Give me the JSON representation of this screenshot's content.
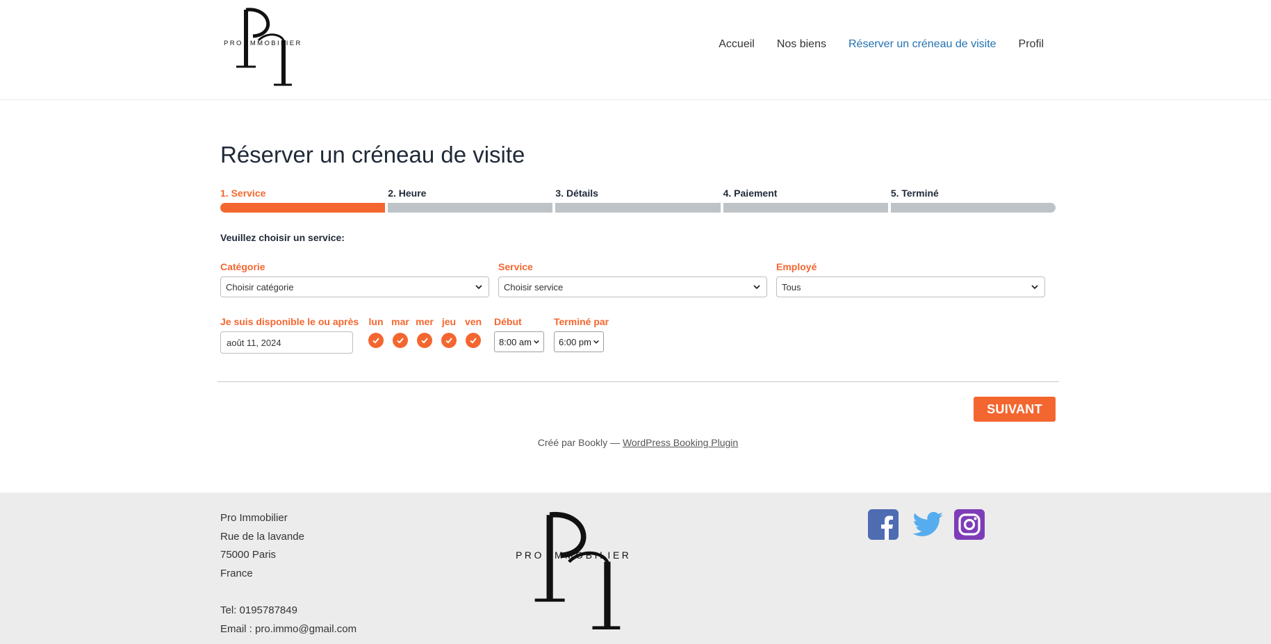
{
  "brand": {
    "logo_text": "PRO IMMOBILIER",
    "accent": "#f4662f",
    "link_active": "#2271b1"
  },
  "nav": {
    "items": [
      {
        "label": "Accueil"
      },
      {
        "label": "Nos biens"
      },
      {
        "label": "Réserver un créneau de visite",
        "active": true
      },
      {
        "label": "Profil"
      }
    ]
  },
  "page": {
    "title": "Réserver un créneau de visite"
  },
  "steps": [
    {
      "label": "1. Service",
      "active": true
    },
    {
      "label": "2. Heure"
    },
    {
      "label": "3. Détails"
    },
    {
      "label": "4. Paiement"
    },
    {
      "label": "5. Terminé"
    }
  ],
  "form": {
    "prompt": "Veuillez choisir un service:",
    "category": {
      "label": "Catégorie",
      "value": "Choisir catégorie"
    },
    "service": {
      "label": "Service",
      "value": "Choisir service"
    },
    "employee": {
      "label": "Employé",
      "value": "Tous"
    },
    "date": {
      "label": "Je suis disponible le ou après",
      "value": "août 11, 2024"
    },
    "days": [
      {
        "label": "lun",
        "checked": true
      },
      {
        "label": "mar",
        "checked": true
      },
      {
        "label": "mer",
        "checked": true
      },
      {
        "label": "jeu",
        "checked": true
      },
      {
        "label": "ven",
        "checked": true
      }
    ],
    "start": {
      "label": "Début",
      "value": "8:00 am"
    },
    "end": {
      "label": "Terminé par",
      "value": "6:00 pm"
    },
    "next_button": "SUIVANT"
  },
  "credit": {
    "prefix": "Créé par Bookly — ",
    "link": "WordPress Booking Plugin"
  },
  "footer": {
    "company": "Pro Immobilier",
    "street": "Rue de la lavande",
    "city": "75000 Paris",
    "country": "France",
    "phone": "Tel: 0195787849",
    "email": "Email : pro.immo@gmail.com",
    "social": [
      {
        "icon": "facebook-icon",
        "color": "#4f6cb3"
      },
      {
        "icon": "twitter-icon",
        "color": "#55acee"
      },
      {
        "icon": "instagram-icon",
        "color": "#7e3db8"
      }
    ]
  }
}
